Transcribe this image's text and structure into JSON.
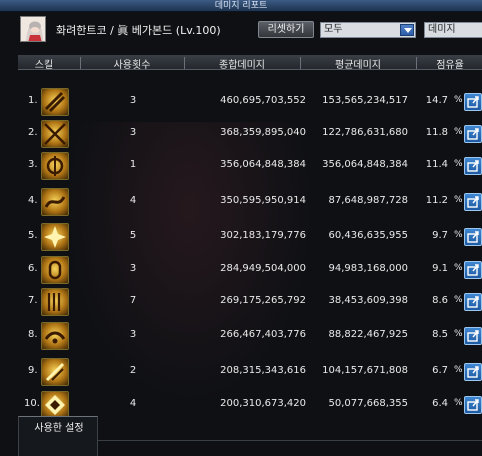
{
  "window": {
    "title": "데미지 리포트"
  },
  "header": {
    "character_name": "화려한트코 / 眞 베가본드 (Lv.100)",
    "reset_label": "리셋하기",
    "filter_select": "모두",
    "type_select": "데미지"
  },
  "table": {
    "columns": [
      "스킬",
      "사용횟수",
      "종합데미지",
      "평균데미지",
      "점유율"
    ],
    "rows": [
      {
        "rank": "1.",
        "count": "3",
        "total": "460,695,703,552",
        "average": "153,565,234,517",
        "share": "14.7"
      },
      {
        "rank": "2.",
        "count": "3",
        "total": "368,359,895,040",
        "average": "122,786,631,680",
        "share": "11.8"
      },
      {
        "rank": "3.",
        "count": "1",
        "total": "356,064,848,384",
        "average": "356,064,848,384",
        "share": "11.4"
      },
      {
        "rank": "4.",
        "count": "4",
        "total": "350,595,950,914",
        "average": "87,648,987,728",
        "share": "11.2"
      },
      {
        "rank": "5.",
        "count": "5",
        "total": "302,183,179,776",
        "average": "60,436,635,955",
        "share": "9.7"
      },
      {
        "rank": "6.",
        "count": "3",
        "total": "284,949,504,000",
        "average": "94,983,168,000",
        "share": "9.1"
      },
      {
        "rank": "7.",
        "count": "7",
        "total": "269,175,265,792",
        "average": "38,453,609,398",
        "share": "8.6"
      },
      {
        "rank": "8.",
        "count": "3",
        "total": "266,467,403,776",
        "average": "88,822,467,925",
        "share": "8.5"
      },
      {
        "rank": "9.",
        "count": "2",
        "total": "208,315,343,616",
        "average": "104,157,671,808",
        "share": "6.7"
      },
      {
        "rank": "10.",
        "count": "4",
        "total": "200,310,673,420",
        "average": "50,077,668,355",
        "share": "6.4"
      }
    ],
    "percent_symbol": "%"
  },
  "footer": {
    "tab_label": "사용한 설정"
  }
}
